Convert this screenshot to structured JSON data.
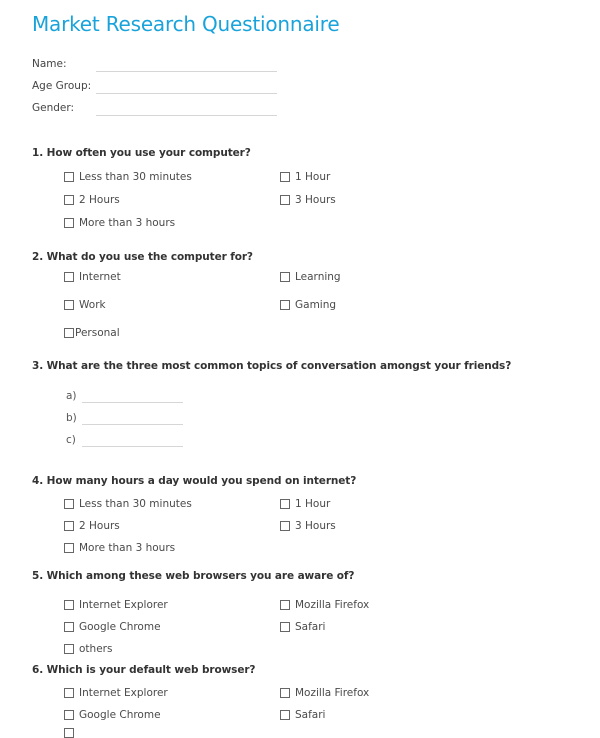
{
  "title": "Market Research Questionnaire",
  "accent_color": "#1aa3db",
  "fields": [
    {
      "label": "Name:",
      "value": ""
    },
    {
      "label": "Age Group:",
      "value": ""
    },
    {
      "label": "Gender:",
      "value": ""
    }
  ],
  "questions": [
    {
      "text": "1. How often you use your computer?",
      "options": [
        {
          "label": "Less than 30 minutes",
          "checked": false
        },
        {
          "label": "1 Hour",
          "checked": false
        },
        {
          "label": "2 Hours",
          "checked": false
        },
        {
          "label": "3 Hours",
          "checked": false
        },
        {
          "label": "More than 3 hours",
          "checked": false
        }
      ]
    },
    {
      "text": "2. What do you use the computer for?",
      "options": [
        {
          "label": "Internet",
          "checked": false
        },
        {
          "label": "Learning",
          "checked": false
        },
        {
          "label": "Work",
          "checked": false
        },
        {
          "label": "Gaming",
          "checked": false
        },
        {
          "label": "Personal",
          "checked": false
        }
      ]
    },
    {
      "text": "3. What are the three most common topics of conversation amongst your friends?",
      "answers": [
        {
          "label": "a)",
          "value": ""
        },
        {
          "label": "b)",
          "value": ""
        },
        {
          "label": "c)",
          "value": ""
        }
      ]
    },
    {
      "text": "4. How many hours a day would you spend on internet?",
      "options": [
        {
          "label": "Less than 30 minutes",
          "checked": false
        },
        {
          "label": "1 Hour",
          "checked": false
        },
        {
          "label": "2 Hours",
          "checked": false
        },
        {
          "label": "3 Hours",
          "checked": false
        },
        {
          "label": "More than 3 hours",
          "checked": false
        }
      ]
    },
    {
      "text": "5. Which among these web browsers you are aware of?",
      "options": [
        {
          "label": "Internet Explorer",
          "checked": false
        },
        {
          "label": "Mozilla Firefox",
          "checked": false
        },
        {
          "label": "Google Chrome",
          "checked": false
        },
        {
          "label": "Safari",
          "checked": false
        },
        {
          "label": "others",
          "checked": false
        }
      ]
    },
    {
      "text": "6. Which is your default web browser?",
      "options": [
        {
          "label": "Internet Explorer",
          "checked": false
        },
        {
          "label": "Mozilla Firefox",
          "checked": false
        },
        {
          "label": "Google Chrome",
          "checked": false
        },
        {
          "label": "Safari",
          "checked": false
        }
      ]
    }
  ]
}
